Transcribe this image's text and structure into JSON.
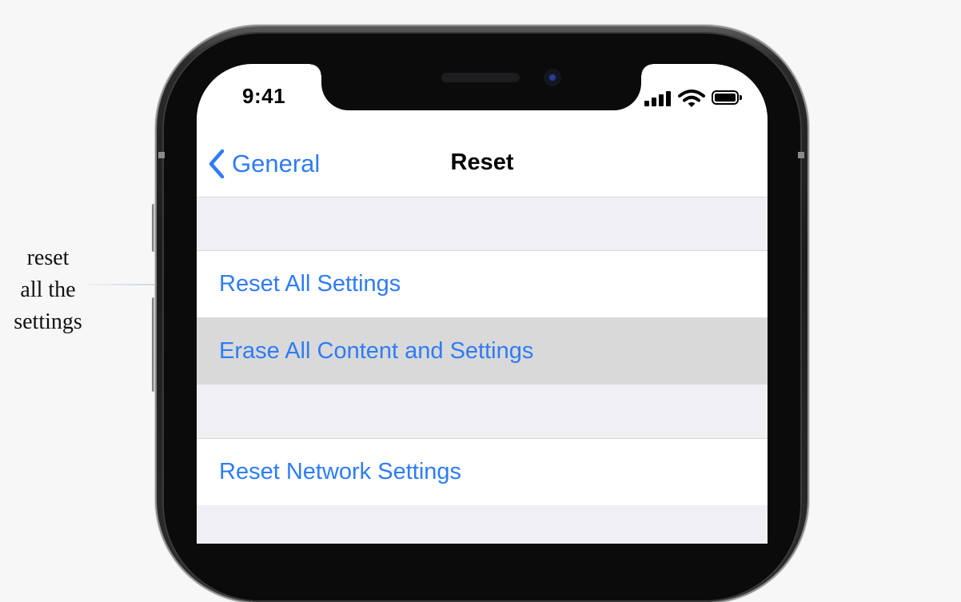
{
  "annotation": {
    "lines": [
      "reset",
      "all the",
      "settings"
    ]
  },
  "status_bar": {
    "time": "9:41",
    "icons": [
      "cellular-signal-icon",
      "wifi-icon",
      "battery-icon"
    ]
  },
  "nav_bar": {
    "back_label": "General",
    "title": "Reset"
  },
  "reset_options": [
    {
      "label": "Reset All Settings",
      "highlighted": false
    },
    {
      "label": "Erase All Content and Settings",
      "highlighted": true
    },
    {
      "label": "Reset Network Settings",
      "highlighted": false
    }
  ],
  "colors": {
    "accent": "#2f7cf6",
    "grouped_background": "#efeff4",
    "highlight": "#d9d9d9",
    "page_background": "#f7f7f7"
  }
}
